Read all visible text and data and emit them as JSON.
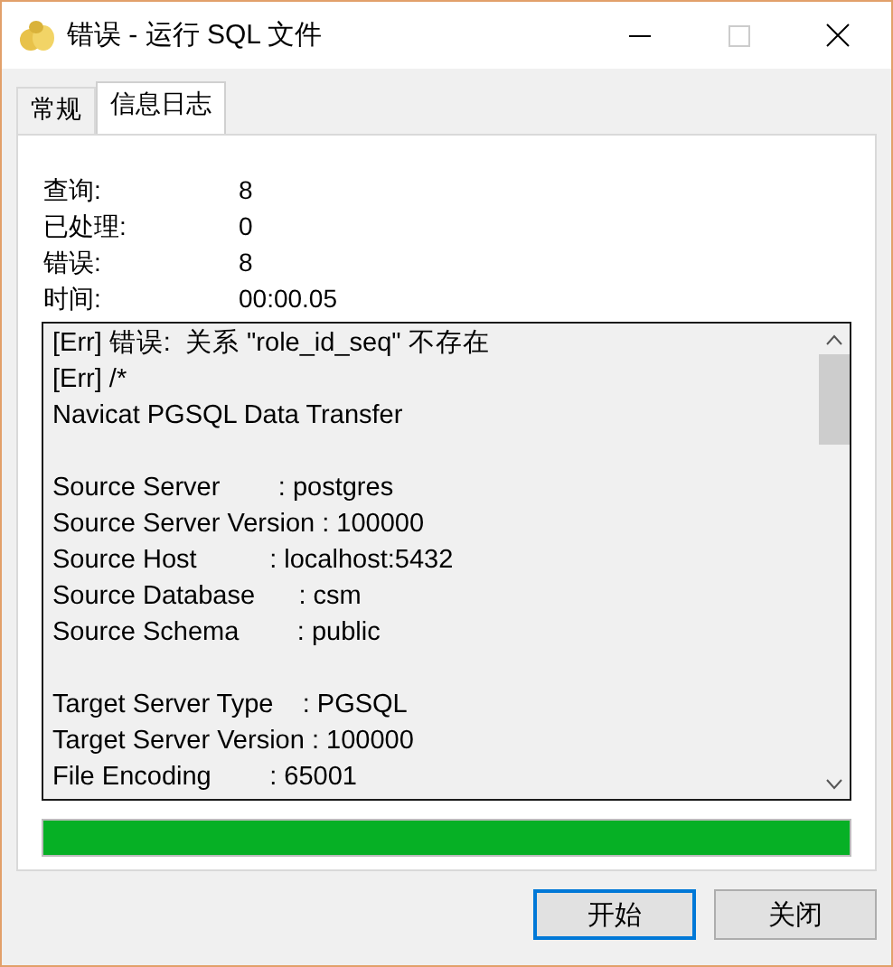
{
  "window": {
    "title": "错误 - 运行 SQL 文件"
  },
  "tabs": [
    {
      "label": "常规",
      "selected": false
    },
    {
      "label": "信息日志",
      "selected": true
    }
  ],
  "stats": [
    {
      "label": "查询:",
      "value": "8"
    },
    {
      "label": "已处理:",
      "value": "0"
    },
    {
      "label": "错误:",
      "value": "8"
    },
    {
      "label": "时间:",
      "value": "00:00.05"
    }
  ],
  "log": {
    "blocks": [
      [
        "[Err] 错误:  关系 \"role_id_seq\" 不存在",
        "[Err] /*",
        "Navicat PGSQL Data Transfer"
      ],
      [
        "Source Server        : postgres",
        "Source Server Version : 100000",
        "Source Host          : localhost:5432",
        "Source Database      : csm",
        "Source Schema        : public"
      ],
      [
        "Target Server Type    : PGSQL",
        "Target Server Version : 100000",
        "File Encoding        : 65001"
      ]
    ]
  },
  "progress": {
    "level": 1
  },
  "buttons": [
    {
      "label": "开始",
      "default": true
    },
    {
      "label": "关闭",
      "default": false
    }
  ]
}
